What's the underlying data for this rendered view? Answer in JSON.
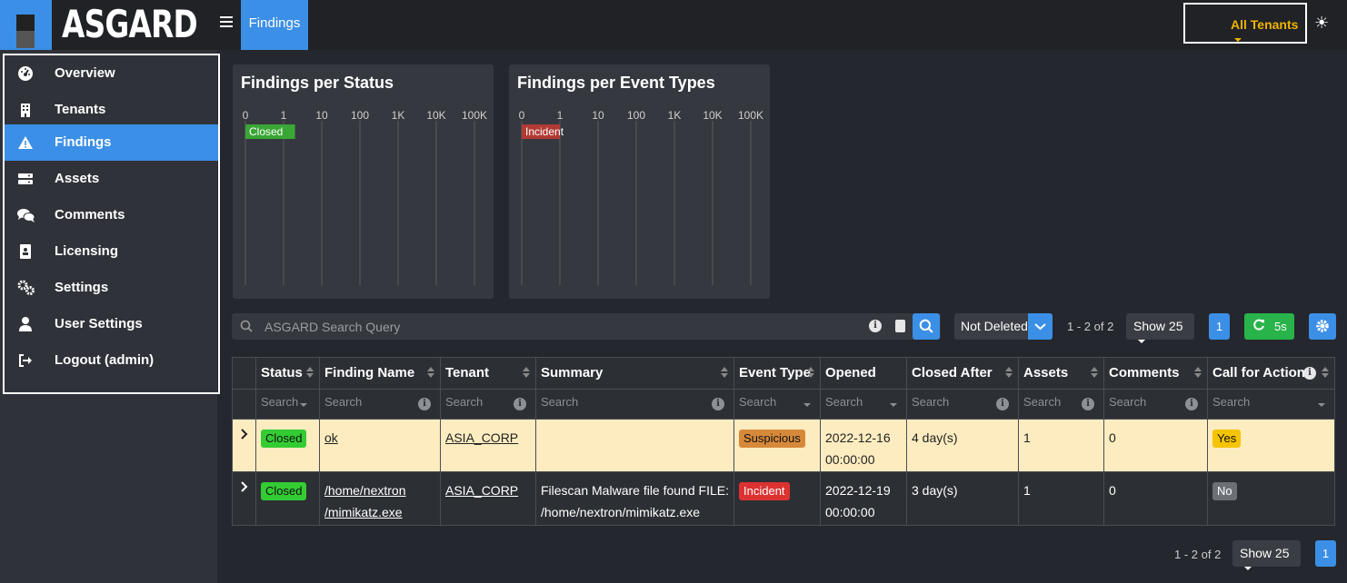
{
  "app": {
    "brand": "ASGARD",
    "active_tab": "Findings",
    "tenant_select": "All Tenants"
  },
  "sidebar": {
    "items": [
      {
        "label": "Overview",
        "icon": "dashboard-icon"
      },
      {
        "label": "Tenants",
        "icon": "building-icon"
      },
      {
        "label": "Findings",
        "icon": "warning-icon",
        "active": true
      },
      {
        "label": "Assets",
        "icon": "server-icon"
      },
      {
        "label": "Comments",
        "icon": "comments-icon"
      },
      {
        "label": "Licensing",
        "icon": "id-card-icon"
      },
      {
        "label": "Settings",
        "icon": "gears-icon"
      },
      {
        "label": "User Settings",
        "icon": "user-icon"
      },
      {
        "label": "Logout (admin)",
        "icon": "sign-out-icon"
      }
    ]
  },
  "chart_data": [
    {
      "type": "bar",
      "title": "Findings per Status",
      "orientation": "horizontal",
      "xscale": "log",
      "xticks": [
        "0",
        "1",
        "10",
        "100",
        "1K",
        "10K",
        "100K"
      ],
      "categories": [
        "Closed"
      ],
      "values": [
        2
      ],
      "colors": [
        "#3aa635"
      ]
    },
    {
      "type": "bar",
      "title": "Findings per Event Types",
      "orientation": "horizontal",
      "xscale": "log",
      "xticks": [
        "0",
        "1",
        "10",
        "100",
        "1K",
        "10K",
        "100K"
      ],
      "categories": [
        "Incident"
      ],
      "values": [
        1
      ],
      "colors": [
        "#b23a34"
      ]
    }
  ],
  "toolbar": {
    "search_placeholder": "ASGARD Search Query",
    "deleted_filter": "Not Deleted",
    "range": "1 - 2 of 2",
    "show": "Show 25",
    "page": "1",
    "refresh": "5s"
  },
  "table": {
    "headers": [
      "Status",
      "Finding Name",
      "Tenant",
      "Summary",
      "Event Type",
      "Opened",
      "Closed After",
      "Assets",
      "Comments",
      "Call for Action"
    ],
    "filter_placeholder": "Search",
    "rows": [
      {
        "status": "Closed",
        "finding_name_1": "ok",
        "finding_name_2": "",
        "tenant": "ASIA_CORP",
        "summary_1": "",
        "summary_2": "",
        "event_type": "Suspicious",
        "opened_1": "2022-12-16",
        "opened_2": "00:00:00",
        "closed_after": "4 day(s)",
        "assets": "1",
        "comments": "0",
        "cta": "Yes"
      },
      {
        "status": "Closed",
        "finding_name_1": "/home/nextron",
        "finding_name_2": "/mimikatz.exe",
        "tenant": "ASIA_CORP",
        "summary_1": "Filescan Malware file found FILE:",
        "summary_2": "/home/nextron/mimikatz.exe",
        "event_type": "Incident",
        "opened_1": "2022-12-19",
        "opened_2": "00:00:00",
        "closed_after": "3 day(s)",
        "assets": "1",
        "comments": "0",
        "cta": "No"
      }
    ]
  },
  "footer": {
    "range": "1 - 2 of 2",
    "show": "Show 25",
    "page": "1"
  }
}
